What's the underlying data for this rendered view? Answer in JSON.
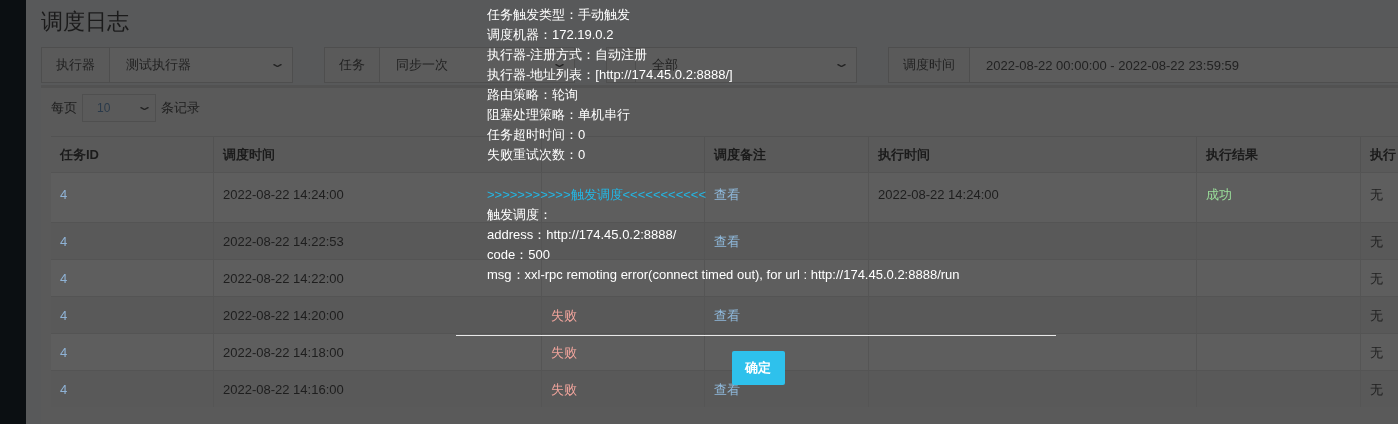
{
  "page_title": "调度日志",
  "filters": [
    {
      "label": "执行器",
      "value": "测试执行器",
      "kind": "select"
    },
    {
      "label": "任务",
      "value": "同步一次",
      "kind": "select"
    },
    {
      "value": "全部",
      "kind": "select"
    },
    {
      "label": "调度时间",
      "value": "2022-08-22 00:00:00 - 2022-08-22 23:59:59",
      "kind": "text"
    }
  ],
  "page_size": {
    "before": "每页",
    "value": "10",
    "after": "条记录"
  },
  "table": {
    "columns": [
      {
        "text": "任务ID"
      },
      {
        "text": "调度时间"
      },
      {},
      {
        "text": "调度备注"
      },
      {
        "text": "执行时间"
      },
      {
        "text": "执行结果"
      },
      {
        "text": "执行"
      }
    ],
    "rows": [
      [
        {
          "text": "4",
          "kind": "id"
        },
        {
          "text": "2022-08-22 14:24:00",
          "kind": "plain"
        },
        {
          "kind": "empty"
        },
        {
          "text": "查看",
          "kind": "link"
        },
        {
          "text": "2022-08-22 14:24:00",
          "kind": "plain"
        },
        {
          "text": "成功",
          "kind": "success"
        },
        {
          "text": "无",
          "kind": "plain"
        }
      ],
      [
        {
          "text": "4",
          "kind": "id"
        },
        {
          "text": "2022-08-22 14:22:53",
          "kind": "plain"
        },
        {
          "kind": "empty"
        },
        {
          "text": "查看",
          "kind": "link"
        },
        {
          "kind": "empty"
        },
        {
          "kind": "empty"
        },
        {
          "text": "无",
          "kind": "plain"
        }
      ],
      [
        {
          "text": "4",
          "kind": "id"
        },
        {
          "text": "2022-08-22 14:22:00",
          "kind": "plain"
        },
        {
          "kind": "empty"
        },
        {
          "kind": "empty"
        },
        {
          "kind": "empty"
        },
        {
          "kind": "empty"
        },
        {
          "text": "无",
          "kind": "plain"
        }
      ],
      [
        {
          "text": "4",
          "kind": "id"
        },
        {
          "text": "2022-08-22 14:20:00",
          "kind": "plain"
        },
        {
          "text": "失败",
          "kind": "fail"
        },
        {
          "text": "查看",
          "kind": "link"
        },
        {
          "kind": "empty"
        },
        {
          "kind": "empty"
        },
        {
          "text": "无",
          "kind": "plain"
        }
      ],
      [
        {
          "text": "4",
          "kind": "id"
        },
        {
          "text": "2022-08-22 14:18:00",
          "kind": "plain"
        },
        {
          "text": "失败",
          "kind": "fail"
        },
        {
          "kind": "empty"
        },
        {
          "kind": "empty"
        },
        {
          "kind": "empty"
        },
        {
          "text": "无",
          "kind": "plain"
        }
      ],
      [
        {
          "text": "4",
          "kind": "id"
        },
        {
          "text": "2022-08-22 14:16:00",
          "kind": "plain"
        },
        {
          "text": "失败",
          "kind": "fail"
        },
        {
          "text": "查看",
          "kind": "link"
        },
        {
          "kind": "empty"
        },
        {
          "kind": "empty"
        },
        {
          "text": "无",
          "kind": "plain"
        }
      ]
    ]
  },
  "dialog": {
    "lines": [
      {
        "text": "任务触发类型：手动触发",
        "kind": "plain"
      },
      {
        "text": "调度机器：172.19.0.2",
        "kind": "plain"
      },
      {
        "text": "执行器-注册方式：自动注册",
        "kind": "plain"
      },
      {
        "text": "执行器-地址列表：[http://174.45.0.2:8888/]",
        "kind": "plain"
      },
      {
        "text": "路由策略：轮询",
        "kind": "plain"
      },
      {
        "text": "阻塞处理策略：单机串行",
        "kind": "plain"
      },
      {
        "text": "任务超时时间：0",
        "kind": "plain"
      },
      {
        "text": "失败重试次数：0",
        "kind": "plain"
      },
      {
        "kind": "spacer"
      },
      {
        "text": ">>>>>>>>>>>触发调度<<<<<<<<<<<",
        "kind": "banner"
      },
      {
        "text": "触发调度：",
        "kind": "plain"
      },
      {
        "text": "address：http://174.45.0.2:8888/",
        "kind": "plain"
      },
      {
        "text": "code：500",
        "kind": "plain"
      },
      {
        "text": "msg：xxl-rpc remoting error(connect timed out), for url : http://174.45.0.2:8888/run",
        "kind": "plain"
      }
    ],
    "button": "确定"
  }
}
